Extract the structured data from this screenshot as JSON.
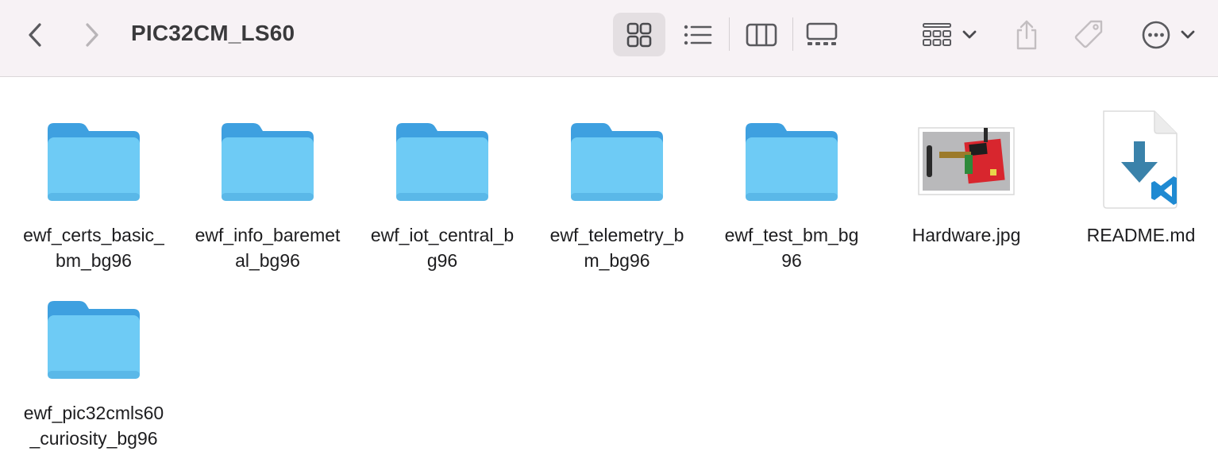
{
  "window": {
    "title": "PIC32CM_LS60"
  },
  "toolbar": {
    "back_icon": "chevron-left-icon",
    "forward_icon": "chevron-right-icon",
    "views": [
      {
        "name": "icon-view",
        "selected": true
      },
      {
        "name": "list-view",
        "selected": false
      },
      {
        "name": "column-view",
        "selected": false
      },
      {
        "name": "gallery-view",
        "selected": false
      }
    ],
    "group_icon": "group-by-icon",
    "share_icon": "share-icon",
    "tag_icon": "tag-icon",
    "more_icon": "ellipsis-circle-icon"
  },
  "colors": {
    "toolbar_bg": "#f7f2f5",
    "folder_body": "#6ecbf5",
    "folder_tab": "#3ea0e0",
    "icon_gray": "#5a5a5e",
    "disabled_gray": "#c3bec1",
    "vscode_blue": "#1f8ad2"
  },
  "items": [
    {
      "label": "ewf_certs_basic_\nbm_bg96",
      "kind": "folder"
    },
    {
      "label": "ewf_info_baremet\nal_bg96",
      "kind": "folder"
    },
    {
      "label": "ewf_iot_central_b\ng96",
      "kind": "folder"
    },
    {
      "label": "ewf_telemetry_b\nm_bg96",
      "kind": "folder"
    },
    {
      "label": "ewf_test_bm_bg\n96",
      "kind": "folder"
    },
    {
      "label": "Hardware.jpg",
      "kind": "image"
    },
    {
      "label": "README.md",
      "kind": "markdown"
    },
    {
      "label": "ewf_pic32cmls60\n_curiosity_bg96",
      "kind": "folder"
    }
  ]
}
